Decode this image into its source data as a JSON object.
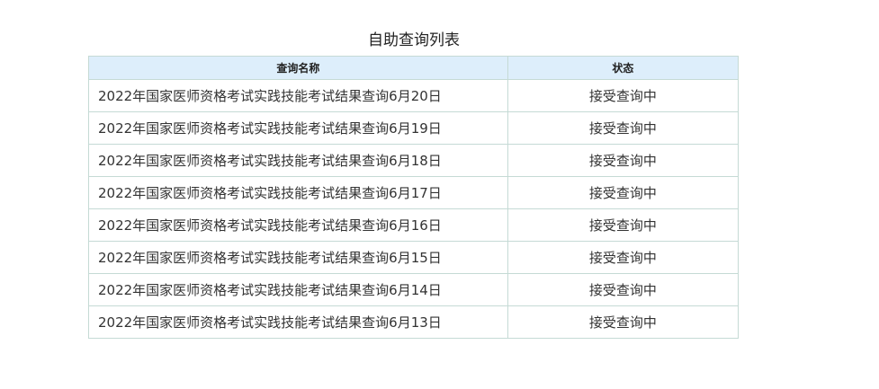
{
  "page": {
    "title": "自助查询列表"
  },
  "table": {
    "headers": {
      "name": "查询名称",
      "status": "状态"
    },
    "rows": [
      {
        "name": "2022年国家医师资格考试实践技能考试结果查询6月20日",
        "status": "接受查询中"
      },
      {
        "name": "2022年国家医师资格考试实践技能考试结果查询6月19日",
        "status": "接受查询中"
      },
      {
        "name": "2022年国家医师资格考试实践技能考试结果查询6月18日",
        "status": "接受查询中"
      },
      {
        "name": "2022年国家医师资格考试实践技能考试结果查询6月17日",
        "status": "接受查询中"
      },
      {
        "name": "2022年国家医师资格考试实践技能考试结果查询6月16日",
        "status": "接受查询中"
      },
      {
        "name": "2022年国家医师资格考试实践技能考试结果查询6月15日",
        "status": "接受查询中"
      },
      {
        "name": "2022年国家医师资格考试实践技能考试结果查询6月14日",
        "status": "接受查询中"
      },
      {
        "name": "2022年国家医师资格考试实践技能考试结果查询6月13日",
        "status": "接受查询中"
      }
    ]
  },
  "colors": {
    "header_bg": "#ddeefb",
    "border": "#c5dad5",
    "text": "#333333"
  }
}
